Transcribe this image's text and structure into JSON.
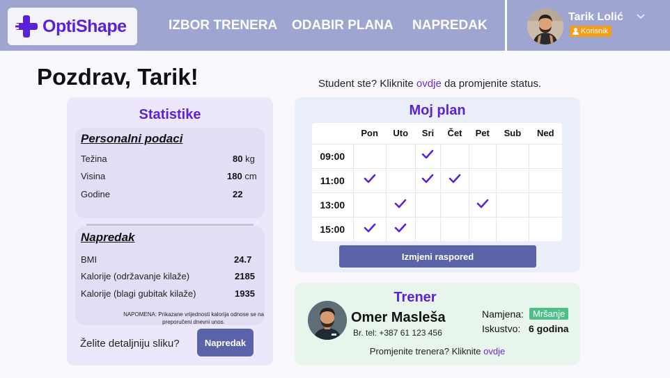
{
  "header": {
    "logo_text": "OptiShape",
    "nav": [
      "IZBOR TRENERA",
      "ODABIR PLANA",
      "NAPREDAK"
    ],
    "user_name": "Tarik Lolić",
    "user_role": "Korisnik"
  },
  "greeting": "Pozdrav, Tarik!",
  "student_notice": {
    "before": "Student ste? Kliknite ",
    "link": "ovdje",
    "after": " da promjenite status."
  },
  "stats": {
    "title": "Statistike",
    "personal": {
      "title": "Personalni podaci",
      "rows": [
        {
          "label": "Težina",
          "value": "80",
          "unit": "kg"
        },
        {
          "label": "Visina",
          "value": "180",
          "unit": "cm"
        },
        {
          "label": "Godine",
          "value": "22",
          "unit": ""
        }
      ]
    },
    "progress": {
      "title": "Napredak",
      "rows": [
        {
          "label": "BMI",
          "value": "24.7"
        },
        {
          "label": "Kalorije (održavanje kilaže)",
          "value": "2185"
        },
        {
          "label": "Kalorije (blagi gubitak kilaže)",
          "value": "1935"
        }
      ]
    },
    "note": "NAPOMENA: Prikazane vrijednosti kalorija odnose se na preporučeni dnevni unos.",
    "detail_question": "Želite detaljniju sliku?",
    "detail_button": "Napredak"
  },
  "plan": {
    "title": "Moj plan",
    "days": [
      "Pon",
      "Uto",
      "Sri",
      "Čet",
      "Pet",
      "Sub",
      "Ned"
    ],
    "rows": [
      {
        "time": "09:00",
        "checks": [
          false,
          false,
          true,
          false,
          false,
          false,
          false
        ]
      },
      {
        "time": "11:00",
        "checks": [
          true,
          false,
          true,
          true,
          false,
          false,
          false
        ]
      },
      {
        "time": "13:00",
        "checks": [
          false,
          true,
          false,
          false,
          true,
          false,
          false
        ]
      },
      {
        "time": "15:00",
        "checks": [
          true,
          true,
          false,
          false,
          false,
          false,
          false
        ]
      }
    ],
    "button": "Izmjeni raspored"
  },
  "trainer": {
    "title": "Trener",
    "name": "Omer Masleša",
    "phone": "Br. tel: +387 61 123 456",
    "goal_label": "Namjena:",
    "goal_value": "Mršanje",
    "exp_label": "Iskustvo:",
    "exp_value": "6 godina",
    "change_before": "Promjenite trenera? Kliknite ",
    "change_link": "ovdje"
  },
  "colors": {
    "accent": "#5b21d9",
    "header": "#9ea5d1",
    "button": "#5b63a8",
    "badge_orange": "#f59e1b",
    "badge_green": "#4dbf87"
  }
}
